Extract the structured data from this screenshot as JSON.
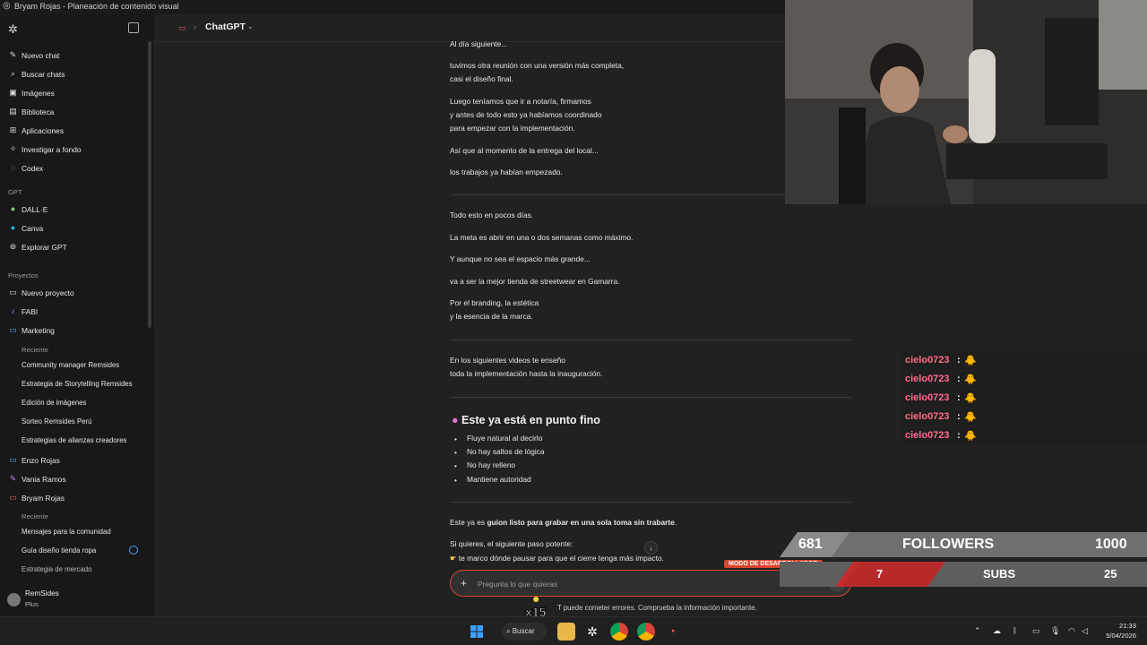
{
  "window": {
    "title": "Bryam Rojas - Planeación de contenido visual"
  },
  "sidebar": {
    "main_items": [
      {
        "label": "Nuevo chat",
        "icon": "edit-icon"
      },
      {
        "label": "Buscar chats",
        "icon": "search-icon"
      },
      {
        "label": "Imágenes",
        "icon": "image-icon"
      },
      {
        "label": "Biblioteca",
        "icon": "library-icon"
      },
      {
        "label": "Aplicaciones",
        "icon": "apps-icon"
      },
      {
        "label": "Investigar a fondo",
        "icon": "research-icon"
      },
      {
        "label": "Codex",
        "icon": "codex-icon"
      }
    ],
    "gpt_heading": "GPT",
    "gpts": [
      {
        "label": "DALL·E",
        "icon": "dalle-icon"
      },
      {
        "label": "Canva",
        "icon": "canva-icon"
      },
      {
        "label": "Explorar GPT",
        "icon": "explore-icon"
      }
    ],
    "projects_heading": "Proyectos",
    "projects": [
      {
        "label": "Nuevo proyecto",
        "icon": "folder-plus-icon"
      },
      {
        "label": "FABI",
        "icon": "music-icon"
      },
      {
        "label": "Marketing",
        "icon": "folder-icon"
      }
    ],
    "marketing_recent_heading": "Reciente",
    "marketing_recent": [
      "Community manager Remsides",
      "Estrategia de Storytelling Remsides",
      "Edición de imágenes",
      "Sorteo Remsides Perú",
      "Estrategias de alianzas creadores"
    ],
    "projects2": [
      {
        "label": "Enzo Rojas",
        "icon": "folder-icon"
      },
      {
        "label": "Vania Ramos",
        "icon": "pencil-icon"
      },
      {
        "label": "Bryam Rojas",
        "icon": "folder-icon"
      }
    ],
    "bryam_recent_heading": "Reciente",
    "bryam_recent": [
      "Mensajes para la comunidad",
      "Guía diseño tienda ropa",
      "Estrategia de mercado"
    ],
    "user": {
      "name": "RemSides",
      "plan": "Plus"
    }
  },
  "topbar": {
    "title": "ChatGPT"
  },
  "message": {
    "paras": [
      "Al día siguiente...",
      "tuvimos otra reunión con una versión más completa,",
      "casi el diseño final.",
      "Luego teníamos que ir a notaría, firmamos",
      "y antes de todo esto ya habíamos coordinado",
      "para empezar con la implementación.",
      "Así que al momento de la entrega del local...",
      "los trabajos ya habían empezado.",
      "Todo esto en pocos días.",
      "La meta es abrir en una o dos semanas como máximo.",
      "Y aunque no sea el espacio más grande...",
      "va a ser la mejor tienda de streetwear en Gamarra.",
      "Por el branding, la estética",
      "y la esencia de la marca.",
      "En los siguientes videos te enseño",
      "toda la implementación hasta la inauguración."
    ],
    "heading": "Este ya está en punto fino",
    "bullets": [
      "Fluye natural al decirlo",
      "No hay saltos de lógica",
      "No hay relleno",
      "Mantiene autoridad"
    ],
    "closing_pre": "Este ya es ",
    "closing_bold": "guion listo para grabar en una sola toma sin trabarte",
    "closing_post": ".",
    "next_step": "Si quieres, el siguiente paso potente:",
    "next_step_item": "te marco dónde pausar para que el cierre tenga más impacto."
  },
  "composer": {
    "placeholder": "Pregunta lo que quieras",
    "dev_badge": "MODO DE DESARROLLADOR",
    "disclaimer": "T puede cometer errores. Comprueba la información importante."
  },
  "stream_chat": [
    {
      "user": "cielo0723",
      "sep": ":",
      "emote": "🐥"
    },
    {
      "user": "cielo0723",
      "sep": ":",
      "emote": "🐥"
    },
    {
      "user": "cielo0723",
      "sep": ":",
      "emote": "🐥"
    },
    {
      "user": "cielo0723",
      "sep": ":",
      "emote": "🐥"
    },
    {
      "user": "cielo0723",
      "sep": ":",
      "emote": "🐥"
    }
  ],
  "stats": {
    "followers_current": "681",
    "followers_label": "FOLLOWERS",
    "followers_goal": "1000",
    "subs_current": "7",
    "subs_label": "SUBS",
    "subs_goal": "25"
  },
  "sticker": {
    "text": "x15"
  },
  "taskbar": {
    "search": "Buscar",
    "time": "21:33",
    "date": "5/04/2026"
  },
  "colors": {
    "accent": "#d9452b",
    "chat_user": "#ff6b8b",
    "bg": "#212121"
  }
}
